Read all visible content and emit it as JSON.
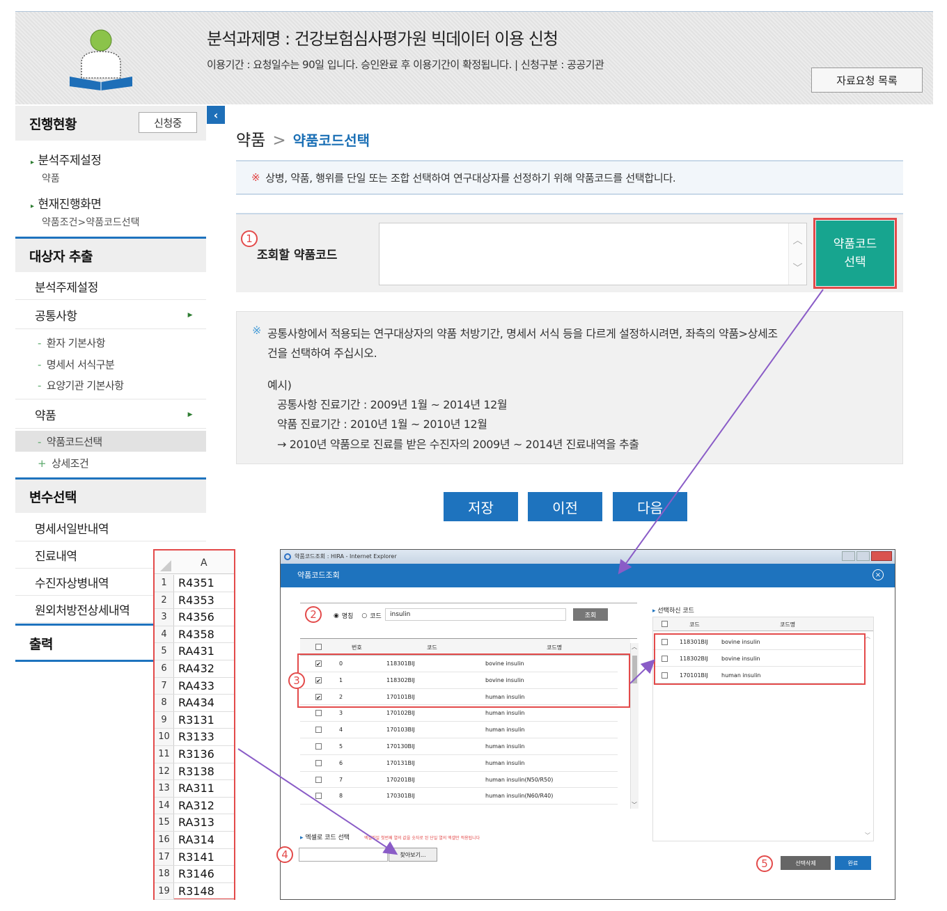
{
  "header": {
    "title": "분석과제명 : 건강보험심사평가원 빅데이터 이용 신청",
    "subtitle": "이용기간 : 요청일수는 90일 입니다. 승인완료 후 이용기간이 확정됩니다.  |  신청구분 : 공공기관",
    "request_list_label": "자료요청 목록"
  },
  "sidebar": {
    "progress_title": "진행현황",
    "status_badge": "신청중",
    "topic_label": "분석주제설정",
    "topic_value": "약품",
    "current_label": "현재진행화면",
    "current_value": "약품조건>약품코드선택",
    "extract_title": "대상자 추출",
    "extract_items": {
      "topic": "분석주제설정",
      "common": "공통사항",
      "common_subs": [
        "환자 기본사항",
        "명세서 서식구분",
        "요양기관 기본사항"
      ],
      "drug": "약품",
      "drug_subs": [
        "약품코드선택",
        "상세조건"
      ]
    },
    "variable_title": "변수선택",
    "variable_items": [
      "명세서일반내역",
      "진료내역",
      "수진자상병내역",
      "원외처방전상세내역"
    ],
    "output_title": "출력"
  },
  "main": {
    "breadcrumb_parent": "약품",
    "breadcrumb_current": "약품코드선택",
    "info_mark": "※",
    "info_note": "상병, 약품, 행위를 단일 또는 조합 선택하여 연구대상자를 선정하기 위해 약품코드를 선택합니다.",
    "query_label": "조회할 약품코드",
    "drug_code_select_line1": "약품코드",
    "drug_code_select_line2": "선택",
    "common_note_line1": "공통사항에서 적용되는 연구대상자의 약품 처방기간, 명세서 서식 등을 다르게 설정하시려면, 좌측의 약품>상세조",
    "common_note_line2": "건을 선택하여 주십시오.",
    "example_label": "예시)",
    "example_line1": "공통사항 진료기간 : 2009년 1월 ~ 2014년 12월",
    "example_line2": "약품 진료기간 : 2010년 1월 ~ 2010년 12월",
    "example_line3": "→ 2010년 약품으로 진료를 받은 수진자의 2009년 ~ 2014년 진료내역을 추출",
    "save_label": "저장",
    "prev_label": "이전",
    "next_label": "다음"
  },
  "markers": [
    "1",
    "2",
    "3",
    "4",
    "5"
  ],
  "excel": {
    "column_header": "A",
    "rows": [
      {
        "n": "1",
        "v": "R4351"
      },
      {
        "n": "2",
        "v": "R4353"
      },
      {
        "n": "3",
        "v": "R4356"
      },
      {
        "n": "4",
        "v": "R4358"
      },
      {
        "n": "5",
        "v": "RA431"
      },
      {
        "n": "6",
        "v": "RA432"
      },
      {
        "n": "7",
        "v": "RA433"
      },
      {
        "n": "8",
        "v": "RA434"
      },
      {
        "n": "9",
        "v": "R3131"
      },
      {
        "n": "10",
        "v": "R3133"
      },
      {
        "n": "11",
        "v": "R3136"
      },
      {
        "n": "12",
        "v": "R3138"
      },
      {
        "n": "13",
        "v": "RA311"
      },
      {
        "n": "14",
        "v": "RA312"
      },
      {
        "n": "15",
        "v": "RA313"
      },
      {
        "n": "16",
        "v": "RA314"
      },
      {
        "n": "17",
        "v": "R3141"
      },
      {
        "n": "18",
        "v": "R3146"
      },
      {
        "n": "19",
        "v": "R3148"
      }
    ]
  },
  "popup": {
    "window_title": "약품코드조회 : HIRA - Internet Explorer",
    "header": "약품코드조회",
    "radio_name": "명칭",
    "radio_code": "코드",
    "search_value": "insulin",
    "search_button": "조회",
    "grid_headers": {
      "no": "번호",
      "code": "코드",
      "name": "코드명"
    },
    "rows": [
      {
        "no": "0",
        "code": "118301BIJ",
        "name": "bovine insulin",
        "checked": true
      },
      {
        "no": "1",
        "code": "118302BIJ",
        "name": "bovine insulin",
        "checked": true
      },
      {
        "no": "2",
        "code": "170101BIJ",
        "name": "human insulin",
        "checked": true
      },
      {
        "no": "3",
        "code": "170102BIJ",
        "name": "human insulin",
        "checked": false
      },
      {
        "no": "4",
        "code": "170103BIJ",
        "name": "human insulin",
        "checked": false
      },
      {
        "no": "5",
        "code": "170130BIJ",
        "name": "human insulin",
        "checked": false
      },
      {
        "no": "6",
        "code": "170131BIJ",
        "name": "human insulin",
        "checked": false
      },
      {
        "no": "7",
        "code": "170201BIJ",
        "name": "human insulin(N50/R50)",
        "checked": false
      },
      {
        "no": "8",
        "code": "170301BIJ",
        "name": "human insulin(N60/R40)",
        "checked": false
      }
    ],
    "selected_title": "선택하신 코드",
    "selected_headers": {
      "code": "코드",
      "name": "코드명"
    },
    "selected_rows": [
      {
        "code": "118301BIJ",
        "name": "bovine insulin"
      },
      {
        "code": "118302BIJ",
        "name": "bovine insulin"
      },
      {
        "code": "170101BIJ",
        "name": "human insulin"
      }
    ],
    "excel_label": "엑셀로 코드 선택",
    "excel_hint": "엑셀파일 첫번째 열의 값을 숫자로 된 단일 열의 엑셀만 적용됩니다",
    "browse_button": "찾아보기...",
    "delete_button": "선택삭제",
    "done_button": "완료"
  },
  "colors": {
    "primary": "#1e73be",
    "teal": "#17a58f",
    "marker": "#e34a4a",
    "arrow": "#8a5cc7"
  }
}
